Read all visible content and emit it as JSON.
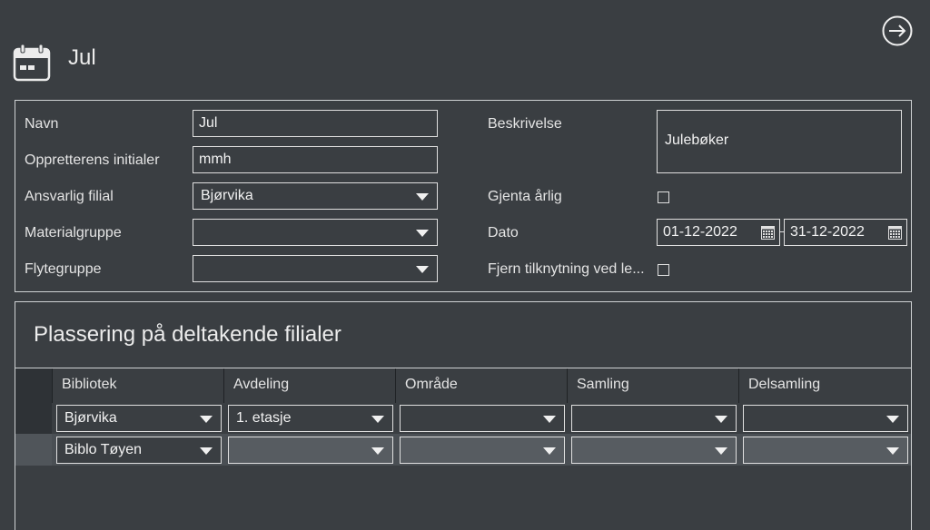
{
  "header": {
    "title": "Jul"
  },
  "form": {
    "name_label": "Navn",
    "name_value": "Jul",
    "initials_label": "Oppretterens initialer",
    "initials_value": "mmh",
    "branch_label": "Ansvarlig filial",
    "branch_value": "Bjørvika",
    "material_label": "Materialgruppe",
    "material_value": "",
    "flow_label": "Flytegruppe",
    "flow_value": "",
    "description_label": "Beskrivelse",
    "description_value": "Julebøker",
    "repeat_label": "Gjenta årlig",
    "date_label": "Dato",
    "date_from": "01-12-2022",
    "date_to": "31-12-2022",
    "remove_label": "Fjern tilknytning ved le..."
  },
  "placement": {
    "title": "Plassering på deltakende filialer",
    "columns": [
      "Bibliotek",
      "Avdeling",
      "Område",
      "Samling",
      "Delsamling"
    ],
    "rows": [
      [
        "Bjørvika",
        "1. etasje",
        "",
        "",
        ""
      ],
      [
        "Biblo Tøyen",
        "",
        "",
        "",
        ""
      ]
    ]
  }
}
